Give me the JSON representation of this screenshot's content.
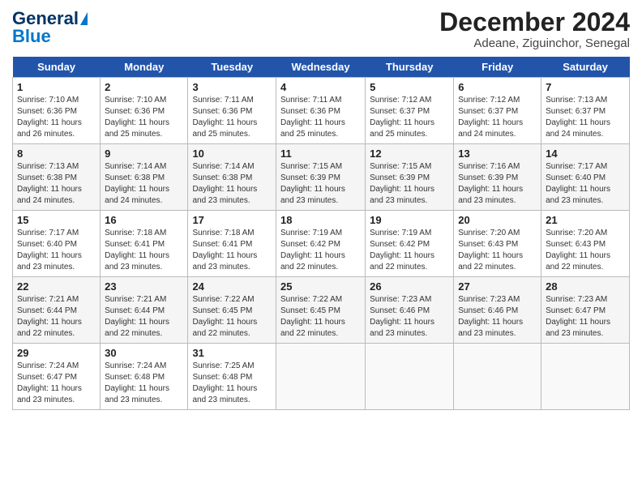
{
  "header": {
    "logo_line1": "General",
    "logo_line2": "Blue",
    "month": "December 2024",
    "location": "Adeane, Ziguinchor, Senegal"
  },
  "days_of_week": [
    "Sunday",
    "Monday",
    "Tuesday",
    "Wednesday",
    "Thursday",
    "Friday",
    "Saturday"
  ],
  "weeks": [
    [
      {
        "day": "1",
        "rise": "7:10 AM",
        "set": "6:36 PM",
        "daylight": "11 hours and 26 minutes."
      },
      {
        "day": "2",
        "rise": "7:10 AM",
        "set": "6:36 PM",
        "daylight": "11 hours and 25 minutes."
      },
      {
        "day": "3",
        "rise": "7:11 AM",
        "set": "6:36 PM",
        "daylight": "11 hours and 25 minutes."
      },
      {
        "day": "4",
        "rise": "7:11 AM",
        "set": "6:36 PM",
        "daylight": "11 hours and 25 minutes."
      },
      {
        "day": "5",
        "rise": "7:12 AM",
        "set": "6:37 PM",
        "daylight": "11 hours and 25 minutes."
      },
      {
        "day": "6",
        "rise": "7:12 AM",
        "set": "6:37 PM",
        "daylight": "11 hours and 24 minutes."
      },
      {
        "day": "7",
        "rise": "7:13 AM",
        "set": "6:37 PM",
        "daylight": "11 hours and 24 minutes."
      }
    ],
    [
      {
        "day": "8",
        "rise": "7:13 AM",
        "set": "6:38 PM",
        "daylight": "11 hours and 24 minutes."
      },
      {
        "day": "9",
        "rise": "7:14 AM",
        "set": "6:38 PM",
        "daylight": "11 hours and 24 minutes."
      },
      {
        "day": "10",
        "rise": "7:14 AM",
        "set": "6:38 PM",
        "daylight": "11 hours and 23 minutes."
      },
      {
        "day": "11",
        "rise": "7:15 AM",
        "set": "6:39 PM",
        "daylight": "11 hours and 23 minutes."
      },
      {
        "day": "12",
        "rise": "7:15 AM",
        "set": "6:39 PM",
        "daylight": "11 hours and 23 minutes."
      },
      {
        "day": "13",
        "rise": "7:16 AM",
        "set": "6:39 PM",
        "daylight": "11 hours and 23 minutes."
      },
      {
        "day": "14",
        "rise": "7:17 AM",
        "set": "6:40 PM",
        "daylight": "11 hours and 23 minutes."
      }
    ],
    [
      {
        "day": "15",
        "rise": "7:17 AM",
        "set": "6:40 PM",
        "daylight": "11 hours and 23 minutes."
      },
      {
        "day": "16",
        "rise": "7:18 AM",
        "set": "6:41 PM",
        "daylight": "11 hours and 23 minutes."
      },
      {
        "day": "17",
        "rise": "7:18 AM",
        "set": "6:41 PM",
        "daylight": "11 hours and 23 minutes."
      },
      {
        "day": "18",
        "rise": "7:19 AM",
        "set": "6:42 PM",
        "daylight": "11 hours and 22 minutes."
      },
      {
        "day": "19",
        "rise": "7:19 AM",
        "set": "6:42 PM",
        "daylight": "11 hours and 22 minutes."
      },
      {
        "day": "20",
        "rise": "7:20 AM",
        "set": "6:43 PM",
        "daylight": "11 hours and 22 minutes."
      },
      {
        "day": "21",
        "rise": "7:20 AM",
        "set": "6:43 PM",
        "daylight": "11 hours and 22 minutes."
      }
    ],
    [
      {
        "day": "22",
        "rise": "7:21 AM",
        "set": "6:44 PM",
        "daylight": "11 hours and 22 minutes."
      },
      {
        "day": "23",
        "rise": "7:21 AM",
        "set": "6:44 PM",
        "daylight": "11 hours and 22 minutes."
      },
      {
        "day": "24",
        "rise": "7:22 AM",
        "set": "6:45 PM",
        "daylight": "11 hours and 22 minutes."
      },
      {
        "day": "25",
        "rise": "7:22 AM",
        "set": "6:45 PM",
        "daylight": "11 hours and 22 minutes."
      },
      {
        "day": "26",
        "rise": "7:23 AM",
        "set": "6:46 PM",
        "daylight": "11 hours and 23 minutes."
      },
      {
        "day": "27",
        "rise": "7:23 AM",
        "set": "6:46 PM",
        "daylight": "11 hours and 23 minutes."
      },
      {
        "day": "28",
        "rise": "7:23 AM",
        "set": "6:47 PM",
        "daylight": "11 hours and 23 minutes."
      }
    ],
    [
      {
        "day": "29",
        "rise": "7:24 AM",
        "set": "6:47 PM",
        "daylight": "11 hours and 23 minutes."
      },
      {
        "day": "30",
        "rise": "7:24 AM",
        "set": "6:48 PM",
        "daylight": "11 hours and 23 minutes."
      },
      {
        "day": "31",
        "rise": "7:25 AM",
        "set": "6:48 PM",
        "daylight": "11 hours and 23 minutes."
      },
      null,
      null,
      null,
      null
    ]
  ],
  "labels": {
    "sunrise": "Sunrise:",
    "sunset": "Sunset:",
    "daylight": "Daylight:"
  }
}
